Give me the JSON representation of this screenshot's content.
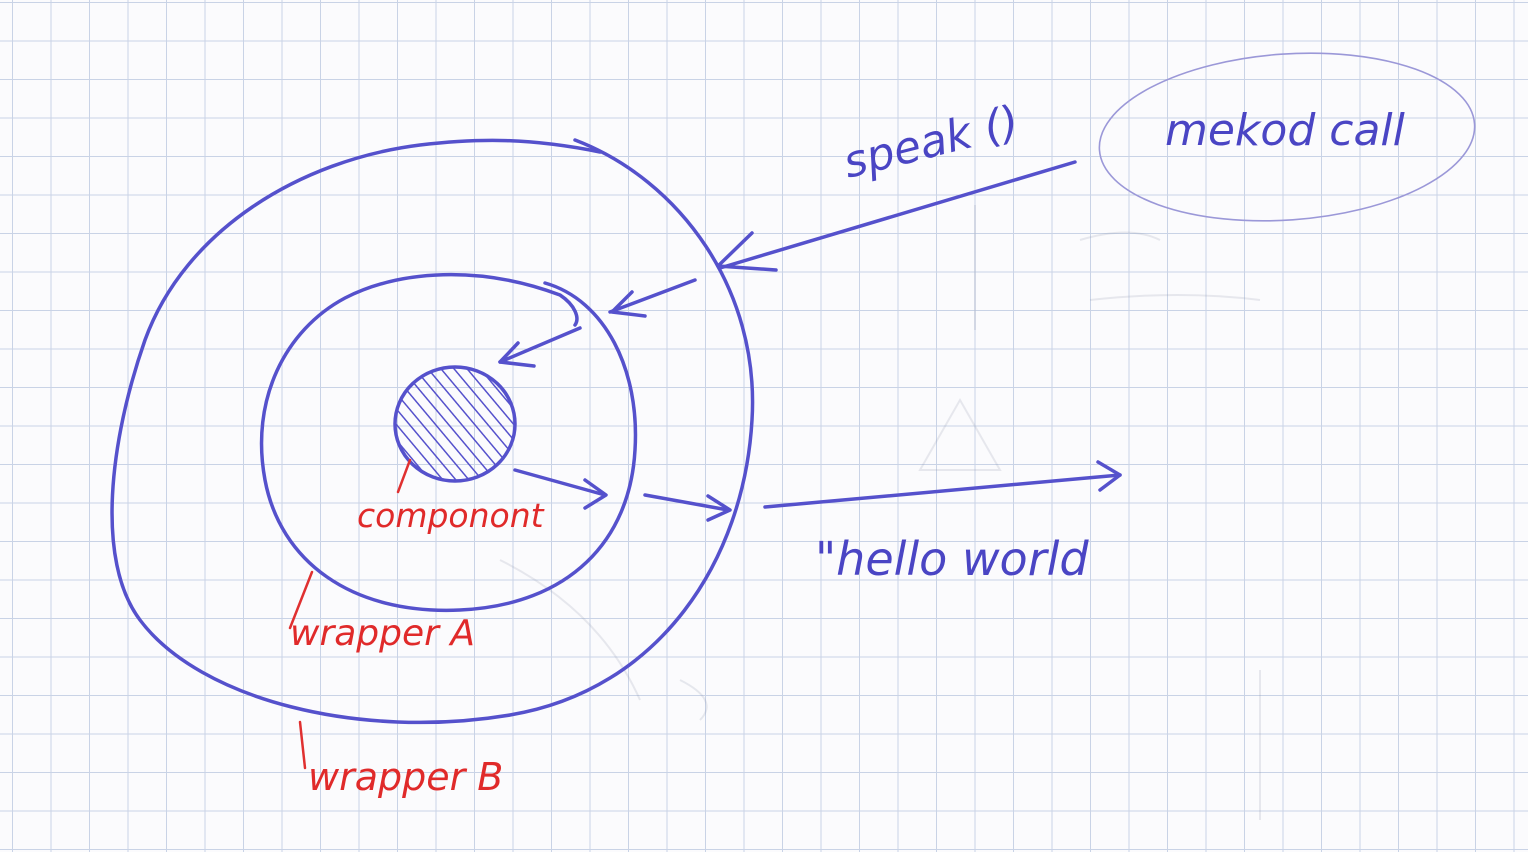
{
  "diagram": {
    "method_call_label": "mekod call",
    "speak_label": "speak ()",
    "hello_label": "\"hello world",
    "component_label": "componont",
    "wrapper_a_label": "wrapper A",
    "wrapper_b_label": "wrapper B"
  },
  "colors": {
    "blue_ink": "#5551cc",
    "red_ink": "#e03030",
    "grid": "#c9d3e6",
    "paper": "#fbfbfd"
  }
}
